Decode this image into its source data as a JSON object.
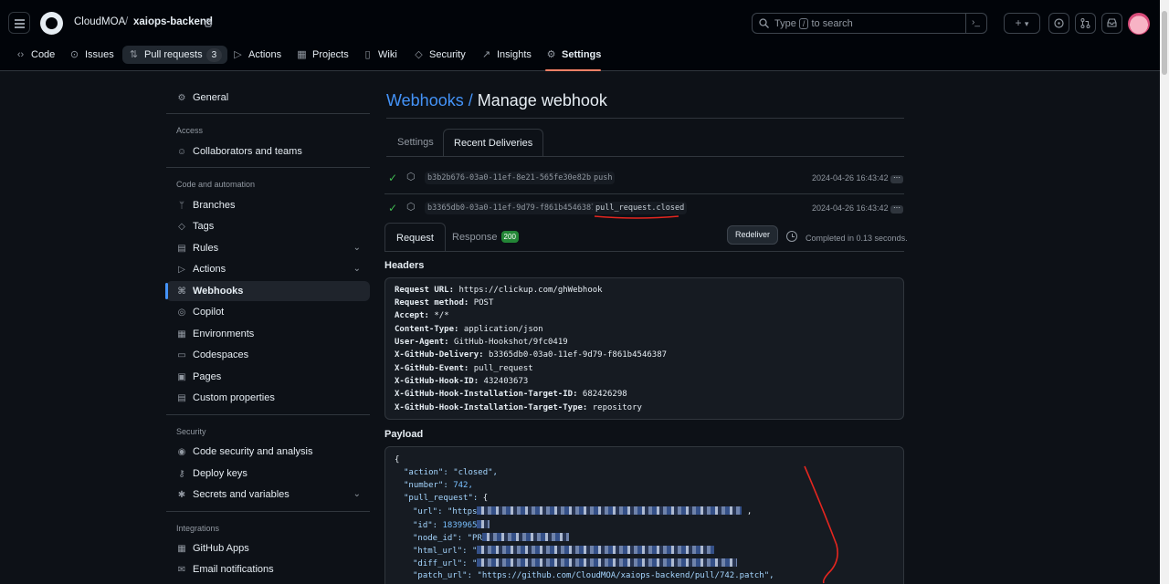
{
  "header": {
    "owner": "CloudMOA",
    "separator": "/",
    "repo": "xaiops-backend",
    "search_before": "Type",
    "search_key": "/",
    "search_after": "to search",
    "plus_icon": "+",
    "caret": "▾",
    "terminal_icon": "›_"
  },
  "repo_tabs": [
    {
      "icon": "‹›",
      "label": "Code"
    },
    {
      "icon": "⊙",
      "label": "Issues"
    },
    {
      "icon": "⇅",
      "label": "Pull requests",
      "count": "3"
    },
    {
      "icon": "▷",
      "label": "Actions"
    },
    {
      "icon": "▦",
      "label": "Projects"
    },
    {
      "icon": "▯",
      "label": "Wiki"
    },
    {
      "icon": "◇",
      "label": "Security"
    },
    {
      "icon": "↗",
      "label": "Insights"
    },
    {
      "icon": "⚙",
      "label": "Settings"
    }
  ],
  "sidebar": {
    "general": "General",
    "access_head": "Access",
    "collaborators": "Collaborators and teams",
    "code_head": "Code and automation",
    "branches": "Branches",
    "tags": "Tags",
    "rules": "Rules",
    "actions": "Actions",
    "webhooks": "Webhooks",
    "copilot": "Copilot",
    "environments": "Environments",
    "codespaces": "Codespaces",
    "pages": "Pages",
    "custom_properties": "Custom properties",
    "security_head": "Security",
    "code_security": "Code security and analysis",
    "deploy_keys": "Deploy keys",
    "secrets": "Secrets and variables",
    "integrations_head": "Integrations",
    "github_apps": "GitHub Apps",
    "email": "Email notifications"
  },
  "page": {
    "title_link": "Webhooks",
    "title_sep": "/",
    "title_rest": "Manage webhook",
    "tab_settings": "Settings",
    "tab_recent": "Recent Deliveries"
  },
  "deliveries": [
    {
      "guid": "b3b2b676-03a0-11ef-8e21-565fe30e82b0",
      "event": "push",
      "date": "2024-04-26 16:43:42",
      "more": "···"
    },
    {
      "guid": "b3365db0-03a0-11ef-9d79-f861b4546387",
      "event": "pull_request.closed",
      "date": "2024-04-26 16:43:42",
      "more": "···"
    }
  ],
  "detail": {
    "tab_request": "Request",
    "tab_response": "Response",
    "status_code": "200",
    "redeliver": "Redeliver",
    "completed": "Completed in 0.13 seconds.",
    "headers_title": "Headers",
    "payload_title": "Payload"
  },
  "headers": [
    {
      "key": "Request URL:",
      "value": "https://clickup.com/ghWebhook"
    },
    {
      "key": "Request method:",
      "value": "POST"
    },
    {
      "key": "Accept:",
      "value": "*/*"
    },
    {
      "key": "Content-Type:",
      "value": "application/json"
    },
    {
      "key": "User-Agent:",
      "value": "GitHub-Hookshot/9fc0419"
    },
    {
      "key": "X-GitHub-Delivery:",
      "value": "b3365db0-03a0-11ef-9d79-f861b4546387"
    },
    {
      "key": "X-GitHub-Event:",
      "value": "pull_request"
    },
    {
      "key": "X-GitHub-Hook-ID:",
      "value": "432403673"
    },
    {
      "key": "X-GitHub-Hook-Installation-Target-ID:",
      "value": "682426298"
    },
    {
      "key": "X-GitHub-Hook-Installation-Target-Type:",
      "value": "repository"
    }
  ],
  "payload": {
    "open": "{",
    "action_key": "\"action\":",
    "action_val": "\"closed\",",
    "number_key": "\"number\":",
    "number_val": "742,",
    "pr_key": "\"pull_request\":",
    "pr_open": "{",
    "url_key": "\"url\":",
    "url_val": "\"https",
    "id_key": "\"id\":",
    "id_val": "1839965",
    "node_id_key": "\"node_id\":",
    "node_id_val": "\"PR",
    "html_url_key": "\"html_url\":",
    "html_url_val": "\"",
    "diff_url_key": "\"diff_url\":",
    "diff_url_val": "\"",
    "patch_url_key": "\"patch_url\":",
    "patch_url_val": "\"https://github.com/CloudMOA/xaiops-backend/pull/742.patch\","
  },
  "colors": {
    "accent": "#f78166",
    "link": "#4493f8",
    "success": "#3fb950",
    "annotation": "#e5261f"
  }
}
